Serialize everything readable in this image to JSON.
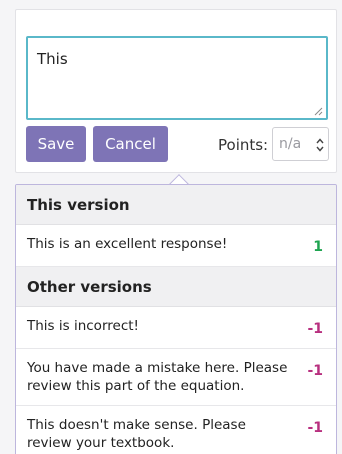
{
  "editor": {
    "text": "This",
    "save_label": "Save",
    "cancel_label": "Cancel",
    "points_label": "Points:",
    "points_placeholder": "n/a"
  },
  "feedback": {
    "this_version_title": "This version",
    "this_version_items": [
      {
        "text": "This is an excellent response!",
        "points": "1"
      }
    ],
    "other_versions_title": "Other versions",
    "other_versions_items": [
      {
        "text": "This is incorrect!",
        "points": "-1"
      },
      {
        "text": "You have made a mistake here. Please review this part of the equation.",
        "points": "-1"
      },
      {
        "text": "This doesn't make sense. Please review your textbook.",
        "points": "-1"
      }
    ]
  },
  "colors": {
    "accent": "#7e74b6",
    "focus_border": "#5ab8c9",
    "positive": "#1ea450",
    "negative": "#b8307f"
  },
  "icons": {
    "resize": "resize-grip-icon",
    "spinner": "spin-arrows-icon"
  }
}
